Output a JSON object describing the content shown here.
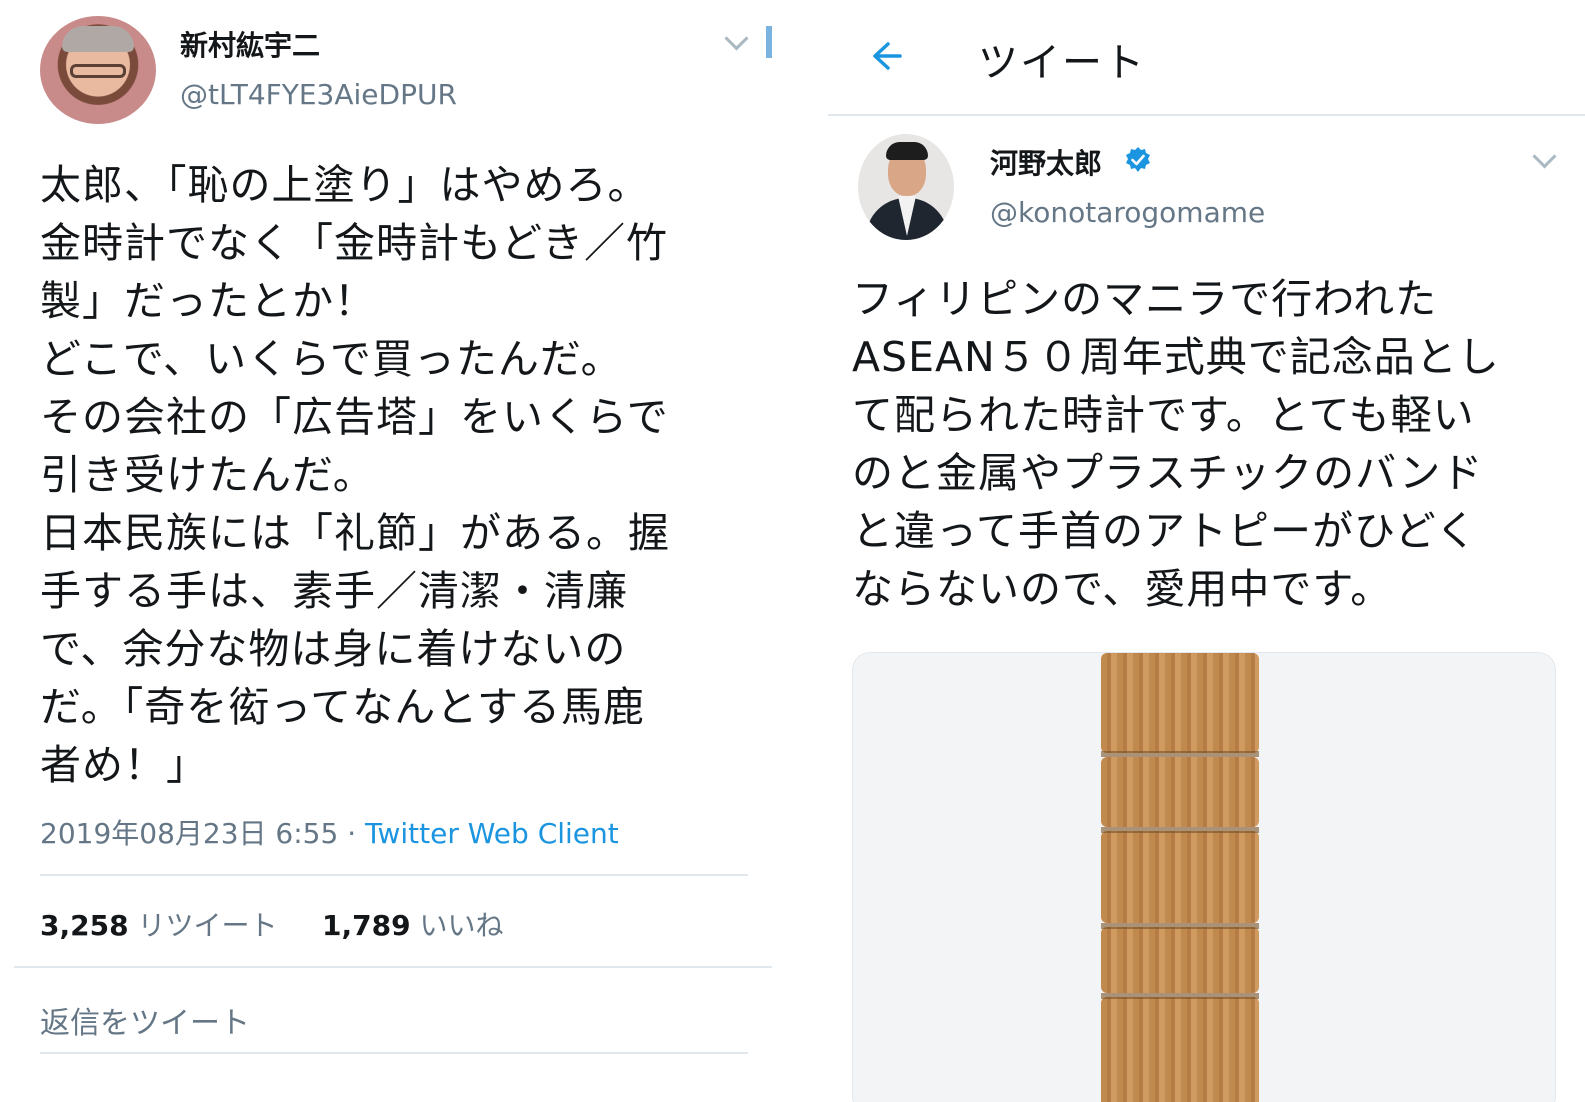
{
  "left_tweet": {
    "author_name": "新村紘宇二",
    "author_handle": "@tLT4FYE3AieDPUR",
    "text_lines": [
      "太郎、「恥の上塗り」はやめろ。",
      "金時計でなく「金時計もどき／竹",
      "製」だったとか！",
      "どこで、いくらで買ったんだ。",
      "その会社の「広告塔」をいくらで",
      "引き受けたんだ。",
      "日本民族には「礼節」がある。握",
      "手する手は、素手／清潔・清廉",
      "で、余分な物は身に着けないの",
      "だ。「奇を衒ってなんとする馬鹿",
      "者め！」"
    ],
    "timestamp": "2019年08月23日 6:55",
    "separator": " · ",
    "client": "Twitter Web Client",
    "retweets_count": "3,258",
    "retweets_label": "リツイート",
    "likes_count": "1,789",
    "likes_label": "いいね",
    "reply_placeholder": "返信をツイート"
  },
  "right_tweet": {
    "header_title": "ツイート",
    "author_name": "河野太郎",
    "author_handle": "@konotarogomame",
    "text_lines": [
      "フィリピンのマニラで行われた",
      "ASEAN５０周年式典で記念品とし",
      "て配られた時計です。とても軽い",
      "のと金属やプラスチックのバンド",
      "と違って手首のアトピーがひどく",
      "ならないので、愛用中です。"
    ]
  },
  "colors": {
    "accent": "#1b95e0",
    "secondary_text": "#657786",
    "primary_text": "#14171a",
    "divider": "#e1e8ed"
  },
  "icons": [
    "chevron-down-icon",
    "back-arrow-icon",
    "verified-badge-icon"
  ]
}
